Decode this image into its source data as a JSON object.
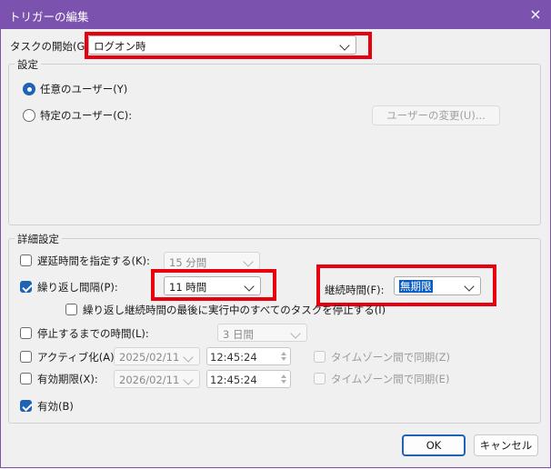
{
  "window": {
    "title": "トリガーの編集",
    "close_icon": "×"
  },
  "begin_task": {
    "label": "タスクの開始(G):",
    "value": "ログオン時"
  },
  "settings": {
    "group_title": "設定",
    "any_user_label": "任意のユーザー(Y)",
    "specific_user_label": "特定のユーザー(C):",
    "change_user_button": "ユーザーの変更(U)..."
  },
  "advanced": {
    "group_title": "詳細設定",
    "delay": {
      "label": "遅延時間を指定する(K):",
      "value": "15 分間"
    },
    "repeat": {
      "label": "繰り返し間隔(P):",
      "value": "11 時間"
    },
    "duration": {
      "label": "継続時間(F):",
      "value": "無期限"
    },
    "stop_at_end_label": "繰り返し継続時間の最後に実行中のすべてのタスクを停止する(I)",
    "stop_after": {
      "label": "停止するまでの時間(L):",
      "value": "3 日間"
    },
    "activate": {
      "label": "アクティブ化(A):",
      "date": "2025/02/11",
      "time": "12:45:24",
      "sync_label": "タイムゾーン間で同期(Z)"
    },
    "expire": {
      "label": "有効期限(X):",
      "date": "2026/02/11",
      "time": "12:45:24",
      "sync_label": "タイムゾーン間で同期(E)"
    },
    "enabled_label": "有効(B)"
  },
  "buttons": {
    "ok": "OK",
    "cancel": "キャンセル"
  }
}
